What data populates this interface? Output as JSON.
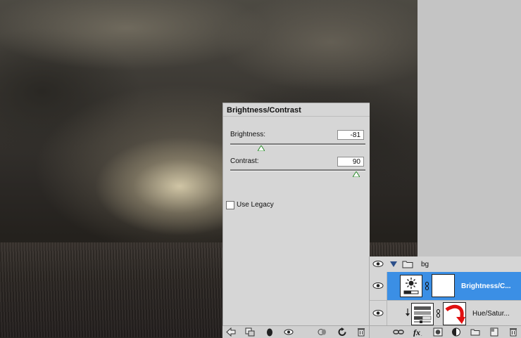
{
  "adjustments": {
    "title": "Brightness/Contrast",
    "brightness": {
      "label": "Brightness:",
      "value": "-81",
      "min": -150,
      "max": 150
    },
    "contrast": {
      "label": "Contrast:",
      "value": "90",
      "min": -50,
      "max": 100
    },
    "use_legacy": {
      "label": "Use Legacy",
      "checked": false
    },
    "toolbar_icons": [
      "return-arrow-icon",
      "clip-to-layer-icon",
      "visibility-toggle-icon",
      "eye-icon",
      "previous-state-icon",
      "reset-icon",
      "delete-icon"
    ]
  },
  "layers": {
    "group": {
      "name": "bg",
      "expanded": true,
      "visible": true
    },
    "items": [
      {
        "name": "Brightness/C...",
        "type": "brightness-contrast",
        "selected": true,
        "visible": true
      },
      {
        "name": "Hue/Satur...",
        "type": "hue-saturation",
        "selected": false,
        "visible": true,
        "clipped": true
      }
    ],
    "toolbar_icons": [
      "link-layers-icon",
      "fx-icon",
      "add-mask-icon",
      "new-adjustment-icon",
      "new-group-icon",
      "new-layer-icon",
      "delete-icon"
    ]
  },
  "colors": {
    "selection": "#3b8fe5",
    "panel_bg": "#d6d6d6",
    "slider_thumb": "#2e8b2e",
    "arrow_annotation": "#e01010"
  }
}
